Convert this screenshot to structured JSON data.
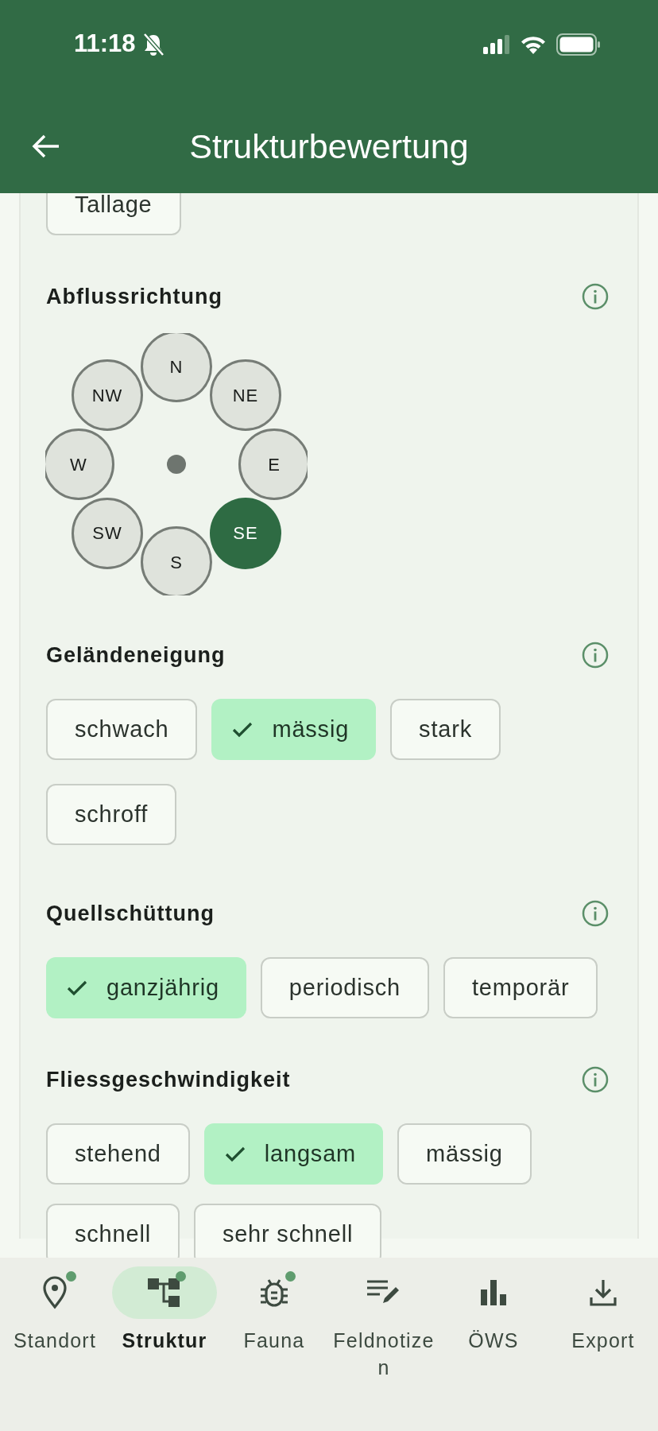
{
  "status_bar": {
    "time": "11:18",
    "silent": true
  },
  "app_bar": {
    "title": "Strukturbewertung"
  },
  "sections": [
    {
      "kind": "chips",
      "options": [
        {
          "label": "Tallage",
          "selected": false
        }
      ]
    },
    {
      "kind": "compass",
      "title": "Abflussrichtung",
      "info": true,
      "directions": [
        {
          "label": "N",
          "selected": false
        },
        {
          "label": "NE",
          "selected": false
        },
        {
          "label": "E",
          "selected": false
        },
        {
          "label": "SE",
          "selected": true
        },
        {
          "label": "S",
          "selected": false
        },
        {
          "label": "SW",
          "selected": false
        },
        {
          "label": "W",
          "selected": false
        },
        {
          "label": "NW",
          "selected": false
        }
      ]
    },
    {
      "kind": "chips",
      "title": "Geländeneigung",
      "info": true,
      "options": [
        {
          "label": "schwach",
          "selected": false
        },
        {
          "label": "mässig",
          "selected": true
        },
        {
          "label": "stark",
          "selected": false
        },
        {
          "label": "schroff",
          "selected": false
        }
      ]
    },
    {
      "kind": "chips",
      "title": "Quellschüttung",
      "info": true,
      "options": [
        {
          "label": "ganzjährig",
          "selected": true
        },
        {
          "label": "periodisch",
          "selected": false
        },
        {
          "label": "temporär",
          "selected": false
        }
      ]
    },
    {
      "kind": "chips",
      "title": "Fliessgeschwindigkeit",
      "info": true,
      "options": [
        {
          "label": "stehend",
          "selected": false
        },
        {
          "label": "langsam",
          "selected": true
        },
        {
          "label": "mässig",
          "selected": false
        },
        {
          "label": "schnell",
          "selected": false
        },
        {
          "label": "sehr schnell",
          "selected": false
        }
      ]
    }
  ],
  "nav": [
    {
      "label": "Standort",
      "selected": false,
      "badge": true
    },
    {
      "label": "Struktur",
      "selected": true,
      "badge": true
    },
    {
      "label": "Fauna",
      "selected": false,
      "badge": true
    },
    {
      "label": "Feldnotizen",
      "selected": false,
      "badge": false
    },
    {
      "label": "ÖWS",
      "selected": false,
      "badge": false
    },
    {
      "label": "Export",
      "selected": false,
      "badge": false
    }
  ]
}
